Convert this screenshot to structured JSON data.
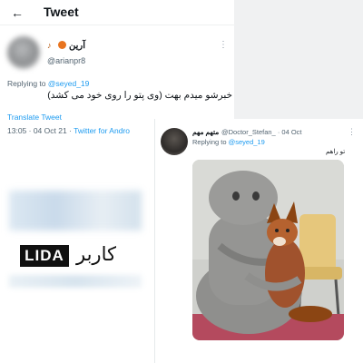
{
  "header": {
    "title": "Tweet",
    "back_icon": "←"
  },
  "tweet": {
    "display_name": "آرین",
    "handle": "@arianpr8",
    "replying_to_prefix": "Replying to ",
    "replying_to_user": "@seyed_19",
    "text": "خبرشو میدم بهت (وی پتو را روی خود می کشد)",
    "translate_label": "Translate Tweet",
    "time": "13:05 · 04 Oct 21 · ",
    "source": "Twitter for Andro",
    "more_icon": "⋮"
  },
  "watermark": {
    "logo_text": "LIDA",
    "caption": "کاربر"
  },
  "reply": {
    "display_name": "متهم مهم",
    "handle_time": "@Doctor_Stefan_ · 04 Oct",
    "replying_to_prefix": "Replying to ",
    "replying_to_user": "@seyed_19",
    "text": "تو راهم",
    "more_icon": "⋮",
    "image_subject": "gray sculpture hugging a fox on a chair"
  },
  "colors": {
    "link": "#1d9bf0",
    "muted": "#536471",
    "text": "#0f1419"
  }
}
